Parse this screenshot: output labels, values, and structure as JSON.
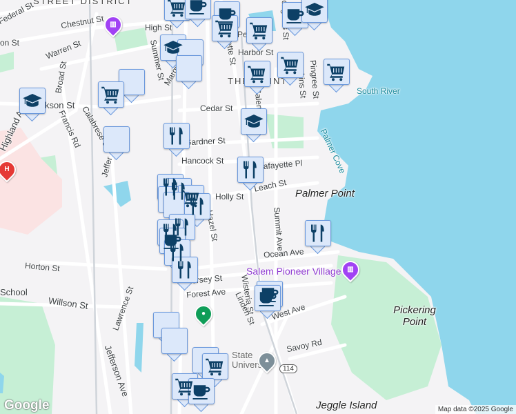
{
  "map": {
    "colors": {
      "water": "#8fd6ec",
      "park": "#c6efd5",
      "hospital_area": "#fbe3e3",
      "road": "#ffffff",
      "marker_bg": "#dce8fa",
      "marker_border": "#6a98dc",
      "icon": "#0d4066",
      "poi_text": "#8e3ad0"
    },
    "labels": {
      "district": "STREET DISTRICT",
      "federal": "Federal St",
      "chestnut": "Chestnut St",
      "high": "High St",
      "warren": "Warren St",
      "summer": "Summer St",
      "margin": "Margin",
      "harbor": "Harbor St",
      "lafayette_top": "ette St",
      "congress": "ongress St",
      "the_point": "THE POINT",
      "salem": "Salem",
      "perkins": "Perkins St",
      "pingree": "Pingree St",
      "peabody": "Pe",
      "south_river": "South River",
      "cedar": "Cedar St",
      "broad": "Broad St",
      "jackson": "kson St",
      "on_st": "on St",
      "francis": "Francis Rd",
      "calabrese": "Calabrese St",
      "highland": "Highland A",
      "jefferson_top": "Jeffer",
      "gardner": "Gardner St",
      "hancock": "Hancock St",
      "lafayette_pl": "Lafayette Pl",
      "palmer_cove": "Palmer Cove",
      "leach": "Leach St",
      "holly": "Holly St",
      "palmer_point": "Palmer Point",
      "hazel": "Hazel St",
      "summit": "Summit Ave",
      "ocean": "Ocean Ave",
      "horton": "Horton St",
      "pioneer": "Salem Pioneer Village",
      "jersey": "Jersey St",
      "forest": "Forest Ave",
      "wisteria": "Wisteria St",
      "linden": "Linden St",
      "school": "School",
      "willson": "Willson St",
      "lawrence": "Lawrence St",
      "west_ave": "West Ave",
      "pickering": "Pickering Point",
      "savoy": "Savoy Rd",
      "university": "State University",
      "route": "114",
      "jefferson_ave": "Jefferson Ave",
      "jeggle": "Jeggle Island",
      "hospital": "H"
    },
    "markers": [
      "cart",
      "coffee",
      "coffee",
      "cart",
      "cart",
      "coffee",
      "graduation-cap",
      "graduation-cap",
      "shopping-bag",
      "shopping-bag",
      "cart",
      "cart",
      "cart",
      "shopping-bag",
      "cart",
      "graduation-cap",
      "graduation-cap",
      "restaurant",
      "shopping-bag",
      "restaurant",
      "restaurant",
      "restaurant",
      "shopping-bag",
      "cart",
      "shopping-bag",
      "restaurant",
      "restaurant",
      "restaurant",
      "coffee",
      "restaurant",
      "restaurant",
      "restaurant",
      "coffee",
      "coffee",
      "shopping-bag",
      "shopping-bag",
      "shopping-bag",
      "cart",
      "cart",
      "coffee"
    ],
    "google_logo": "Google",
    "attribution": "Map data ©2025 Google"
  }
}
